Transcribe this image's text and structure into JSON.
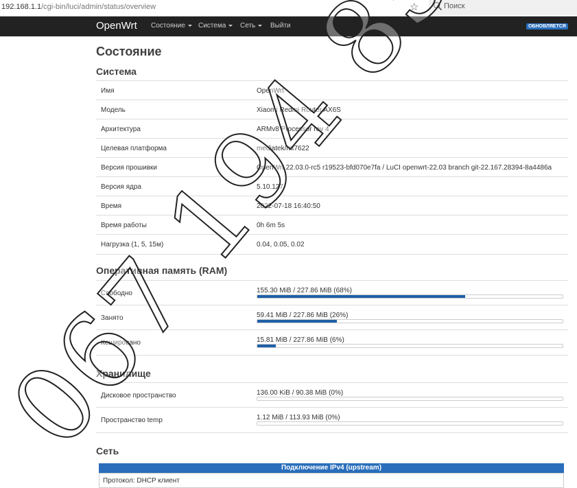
{
  "browser": {
    "url_host": "192.168.1.1",
    "url_path": "/cgi-bin/luci/admin/status/overview",
    "search_placeholder": "Поиск"
  },
  "navbar": {
    "brand": "OpenWrt",
    "items": [
      {
        "label": "Состояние",
        "dropdown": true
      },
      {
        "label": "Система",
        "dropdown": true
      },
      {
        "label": "Сеть",
        "dropdown": true
      },
      {
        "label": "Выйти",
        "dropdown": false
      }
    ],
    "badge": "ОБНОВЛЯЕТСЯ"
  },
  "page": {
    "title": "Состояние"
  },
  "system": {
    "title": "Система",
    "rows": [
      {
        "key": "Имя",
        "value": "OpenWrt"
      },
      {
        "key": "Модель",
        "value": "Xiaomi Redmi Router AX6S"
      },
      {
        "key": "Архитектура",
        "value": "ARMv8 Processor rev 4"
      },
      {
        "key": "Целевая платформа",
        "value": "mediatek/mt7622"
      },
      {
        "key": "Версия прошивки",
        "value": "OpenWrt 22.03.0-rc5 r19523-bfd070e7fa / LuCI openwrt-22.03 branch git-22.167.28394-8a4486a"
      },
      {
        "key": "Версия ядра",
        "value": "5.10.127"
      },
      {
        "key": "Время",
        "value": "2022-07-18 16:40:50"
      },
      {
        "key": "Время работы",
        "value": "0h 6m 5s"
      },
      {
        "key": "Нагрузка (1, 5, 15м)",
        "value": "0.04, 0.05, 0.02"
      }
    ]
  },
  "ram": {
    "title": "Оперативная память (RAM)",
    "rows": [
      {
        "key": "Свободно",
        "value": "155.30 MiB / 227.86 MiB (68%)",
        "percent": 68
      },
      {
        "key": "Занято",
        "value": "59.41 MiB / 227.86 MiB (26%)",
        "percent": 26
      },
      {
        "key": "Кешировано",
        "value": "15.81 MiB / 227.86 MiB (6%)",
        "percent": 6
      }
    ]
  },
  "storage": {
    "title": "Хранилище",
    "rows": [
      {
        "key": "Дисковое пространство",
        "value": "136.00 KiB / 90.38 MiB (0%)",
        "percent": 0
      },
      {
        "key": "Пространство temp",
        "value": "1.12 MiB / 113.93 MiB (0%)",
        "percent": 0
      }
    ]
  },
  "network": {
    "title": "Сеть",
    "ipv4_header": "Подключение IPv4 (upstream)",
    "protocol_label": "Протокол: DHCP клиент"
  },
  "watermark": {
    "text": "067 194 85 08"
  }
}
